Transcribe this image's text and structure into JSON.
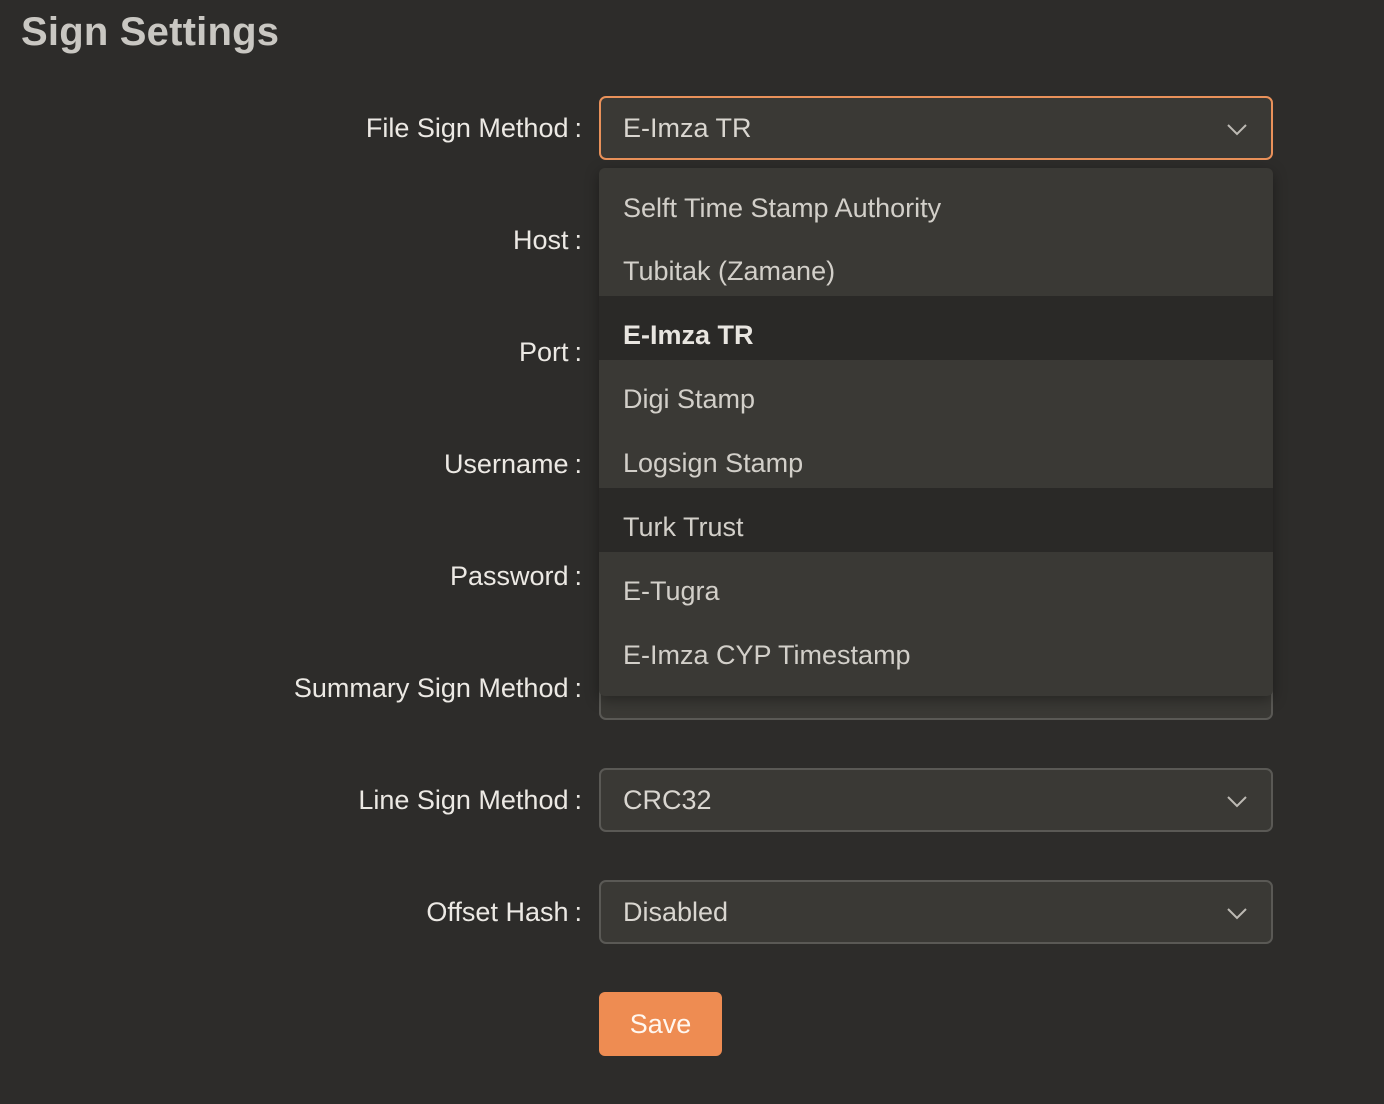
{
  "page": {
    "title": "Sign Settings"
  },
  "form": {
    "file_sign_method": {
      "label": "File Sign Method",
      "value": "E-Imza TR"
    },
    "host": {
      "label": "Host"
    },
    "port": {
      "label": "Port"
    },
    "username": {
      "label": "Username"
    },
    "password": {
      "label": "Password"
    },
    "summary_sign_method": {
      "label": "Summary Sign Method"
    },
    "line_sign_method": {
      "label": "Line Sign Method",
      "value": "CRC32"
    },
    "offset_hash": {
      "label": "Offset Hash",
      "value": "Disabled"
    },
    "colon": ":",
    "save_label": "Save"
  },
  "dropdown": {
    "options": [
      "Selft Time Stamp Authority",
      "Tubitak (Zamane)",
      "E-Imza TR",
      "Digi Stamp",
      "Logsign Stamp",
      "Turk Trust",
      "E-Tugra",
      "E-Imza CYP Timestamp"
    ],
    "selected": "E-Imza TR",
    "hovered": "Turk Trust"
  },
  "colors": {
    "background": "#2d2c2a",
    "field_background": "#3a3935",
    "focus_border": "#e9915a",
    "accent_button": "#ee8c52"
  },
  "icons": {
    "select_arrow": "chevron-down-icon"
  }
}
